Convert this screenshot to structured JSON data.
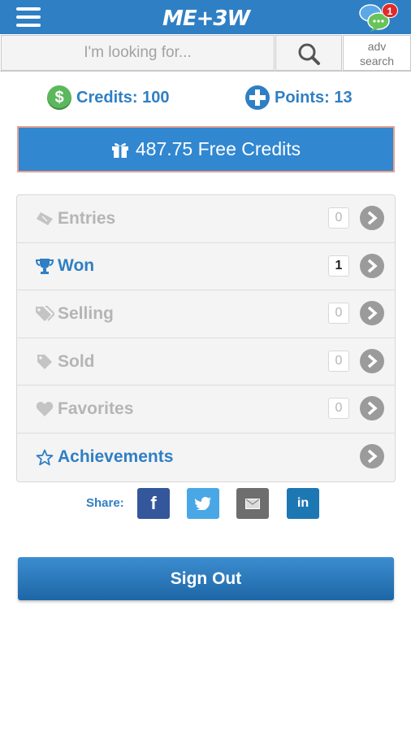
{
  "header": {
    "logo_text": "ME+3W",
    "notification_count": "1",
    "brand_color": "#2f7fc4"
  },
  "search": {
    "placeholder": "I'm looking for...",
    "adv_line1": "adv",
    "adv_line2": "search"
  },
  "stats": {
    "credits_label": "Credits: 100",
    "points_label": "Points: 13",
    "coin_symbol": "$"
  },
  "free_credits": {
    "label": "487.75 Free Credits"
  },
  "menu": {
    "items": [
      {
        "label": "Entries",
        "icon": "ticket-icon",
        "count": "0",
        "state": "muted"
      },
      {
        "label": "Won",
        "icon": "trophy-icon",
        "count": "1",
        "state": "active"
      },
      {
        "label": "Selling",
        "icon": "tags-icon",
        "count": "0",
        "state": "muted"
      },
      {
        "label": "Sold",
        "icon": "tag-icon",
        "count": "0",
        "state": "muted"
      },
      {
        "label": "Favorites",
        "icon": "heart-icon",
        "count": "0",
        "state": "muted"
      },
      {
        "label": "Achievements",
        "icon": "star-outline-icon",
        "count": null,
        "state": "active"
      }
    ]
  },
  "share": {
    "label": "Share:",
    "facebook": "f",
    "linkedin": "in"
  },
  "sign_out": {
    "label": "Sign Out"
  }
}
